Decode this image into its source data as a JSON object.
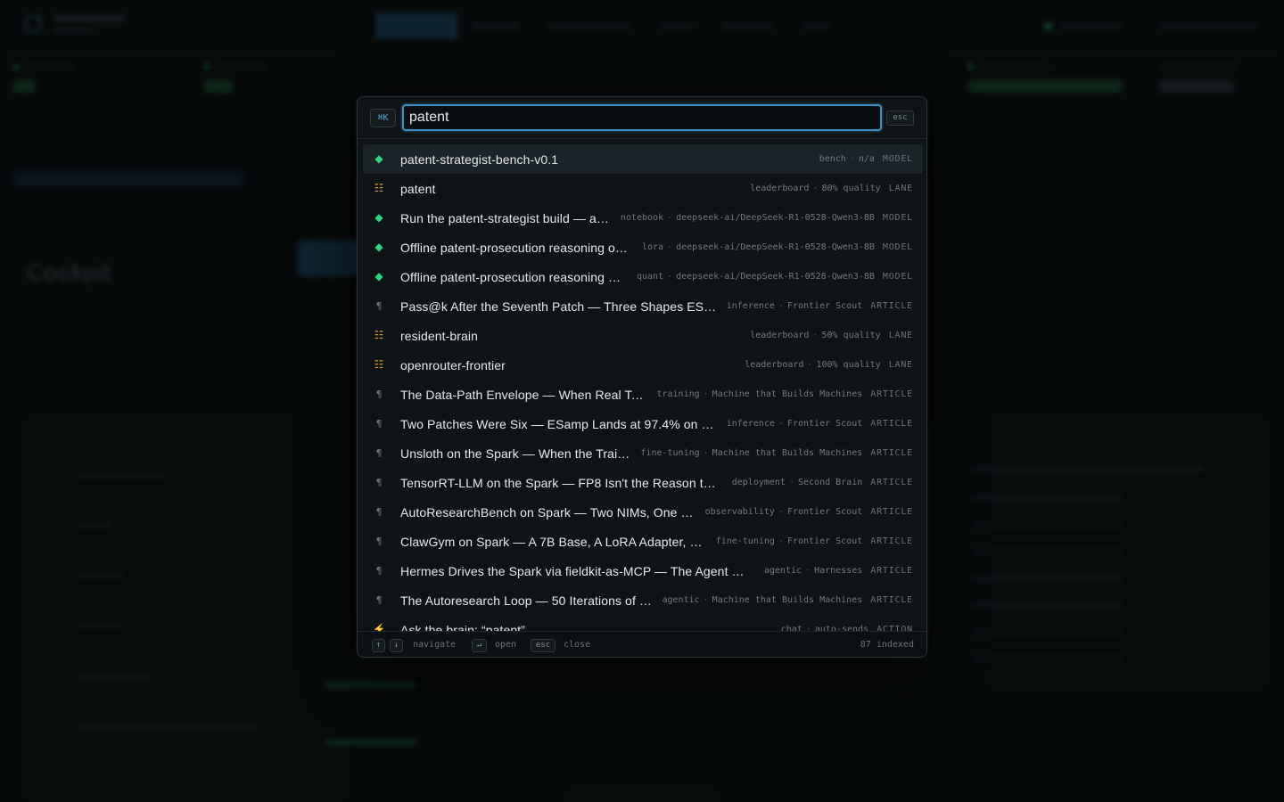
{
  "background": {
    "page_title": "Cockpit"
  },
  "palette": {
    "shortcut_badge": "⌘K",
    "search": {
      "value": "patent",
      "placeholder": ""
    },
    "esc_label": "esc",
    "results": [
      {
        "icon": "diamond-icon",
        "kind_icon": "model",
        "label": "patent-strategist-bench-v0.1",
        "tag": "bench",
        "detail": "n/a",
        "kind": "MODEL",
        "active": true
      },
      {
        "icon": "list-icon",
        "kind_icon": "lane",
        "label": "patent",
        "tag": "leaderboard",
        "detail": "80% quality",
        "kind": "LANE"
      },
      {
        "icon": "diamond-icon",
        "kind_icon": "model",
        "label": "Run the patent-strategist build — a…",
        "tag": "notebook",
        "detail": "deepseek-ai/DeepSeek-R1-0528-Qwen3-8B",
        "kind": "MODEL"
      },
      {
        "icon": "diamond-icon",
        "kind_icon": "model",
        "label": "Offline patent-prosecution reasoning o…",
        "tag": "lora",
        "detail": "deepseek-ai/DeepSeek-R1-0528-Qwen3-8B",
        "kind": "MODEL"
      },
      {
        "icon": "diamond-icon",
        "kind_icon": "model",
        "label": "Offline patent-prosecution reasoning …",
        "tag": "quant",
        "detail": "deepseek-ai/DeepSeek-R1-0528-Qwen3-8B",
        "kind": "MODEL"
      },
      {
        "icon": "pilcrow-icon",
        "kind_icon": "article",
        "label": "Pass@k After the Seventh Patch — Three Shapes ES…",
        "tag": "inference",
        "detail": "Frontier Scout",
        "kind": "ARTICLE"
      },
      {
        "icon": "list-icon",
        "kind_icon": "lane",
        "label": "resident-brain",
        "tag": "leaderboard",
        "detail": "50% quality",
        "kind": "LANE"
      },
      {
        "icon": "list-icon",
        "kind_icon": "lane",
        "label": "openrouter-frontier",
        "tag": "leaderboard",
        "detail": "100% quality",
        "kind": "LANE"
      },
      {
        "icon": "pilcrow-icon",
        "kind_icon": "article",
        "label": "The Data-Path Envelope — When Real To…",
        "tag": "training",
        "detail": "Machine that Builds Machines",
        "kind": "ARTICLE"
      },
      {
        "icon": "pilcrow-icon",
        "kind_icon": "article",
        "label": "Two Patches Were Six — ESamp Lands at 97.4% on a…",
        "tag": "inference",
        "detail": "Frontier Scout",
        "kind": "ARTICLE"
      },
      {
        "icon": "pilcrow-icon",
        "kind_icon": "article",
        "label": "Unsloth on the Spark — When the Trai…",
        "tag": "fine-tuning",
        "detail": "Machine that Builds Machines",
        "kind": "ARTICLE"
      },
      {
        "icon": "pilcrow-icon",
        "kind_icon": "article",
        "label": "TensorRT-LLM on the Spark — FP8 Isn't the Reason t…",
        "tag": "deployment",
        "detail": "Second Brain",
        "kind": "ARTICLE"
      },
      {
        "icon": "pilcrow-icon",
        "kind_icon": "article",
        "label": "AutoResearchBench on Spark — Two NIMs, One …",
        "tag": "observability",
        "detail": "Frontier Scout",
        "kind": "ARTICLE"
      },
      {
        "icon": "pilcrow-icon",
        "kind_icon": "article",
        "label": "ClawGym on Spark — A 7B Base, A LoRA Adapter, a…",
        "tag": "fine-tuning",
        "detail": "Frontier Scout",
        "kind": "ARTICLE"
      },
      {
        "icon": "pilcrow-icon",
        "kind_icon": "article",
        "label": "Hermes Drives the Spark via fieldkit-as-MCP — The Agent …",
        "tag": "agentic",
        "detail": "Harnesses",
        "kind": "ARTICLE"
      },
      {
        "icon": "pilcrow-icon",
        "kind_icon": "article",
        "label": "The Autoresearch Loop — 50 Iterations of …",
        "tag": "agentic",
        "detail": "Machine that Builds Machines",
        "kind": "ARTICLE"
      },
      {
        "icon": "bolt-icon",
        "kind_icon": "action",
        "label": "Ask the brain: “patent”",
        "tag": "chat",
        "detail": "auto-sends",
        "kind": "ACTION"
      }
    ],
    "footer": {
      "up_key": "↑",
      "down_key": "↓",
      "navigate_label": "navigate",
      "enter_key": "↵",
      "open_label": "open",
      "esc_key": "esc",
      "close_label": "close",
      "indexed_label": "87 indexed"
    }
  }
}
